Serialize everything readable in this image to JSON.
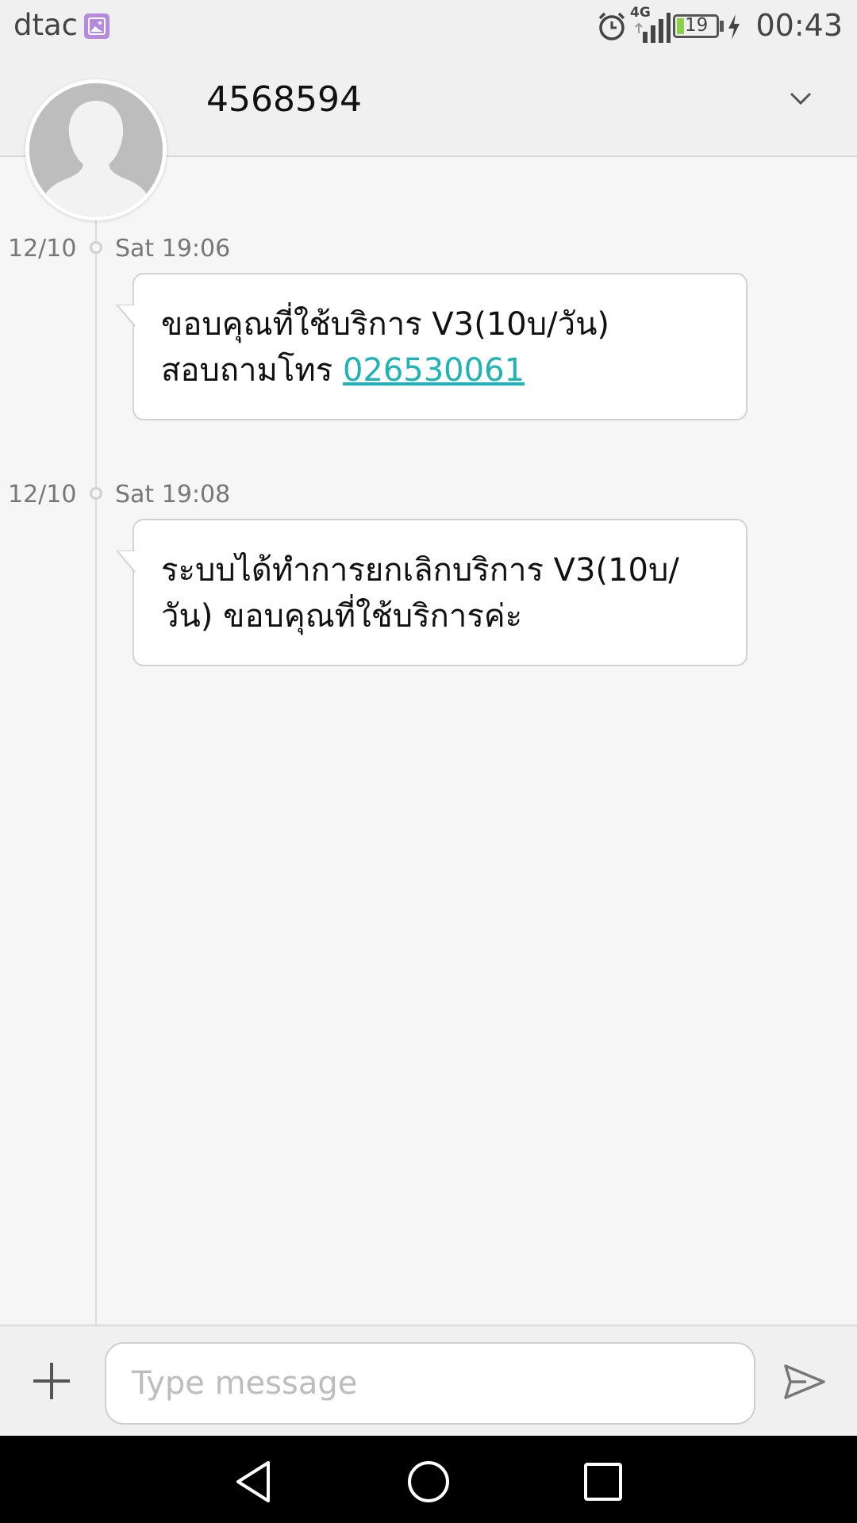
{
  "status_bar": {
    "carrier": "dtac",
    "network_type": "4G",
    "battery_level": "19",
    "time": "00:43"
  },
  "header": {
    "contact_name": "4568594"
  },
  "messages": [
    {
      "date": "12/10",
      "time": "Sat 19:06",
      "text_before_link": "ขอบคุณที่ใช้บริการ V3(10บ/วัน) สอบถามโทร ",
      "link": "026530061"
    },
    {
      "date": "12/10",
      "time": "Sat 19:08",
      "text": "ระบบได้ทำการยกเลิกบริการ V3(10บ/วัน) ขอบคุณที่ใช้บริการค่ะ"
    }
  ],
  "composer": {
    "placeholder": "Type message"
  },
  "colors": {
    "link": "#1fb3b7",
    "gallery_badge": "#b48be0",
    "battery": "#8cd04a"
  }
}
